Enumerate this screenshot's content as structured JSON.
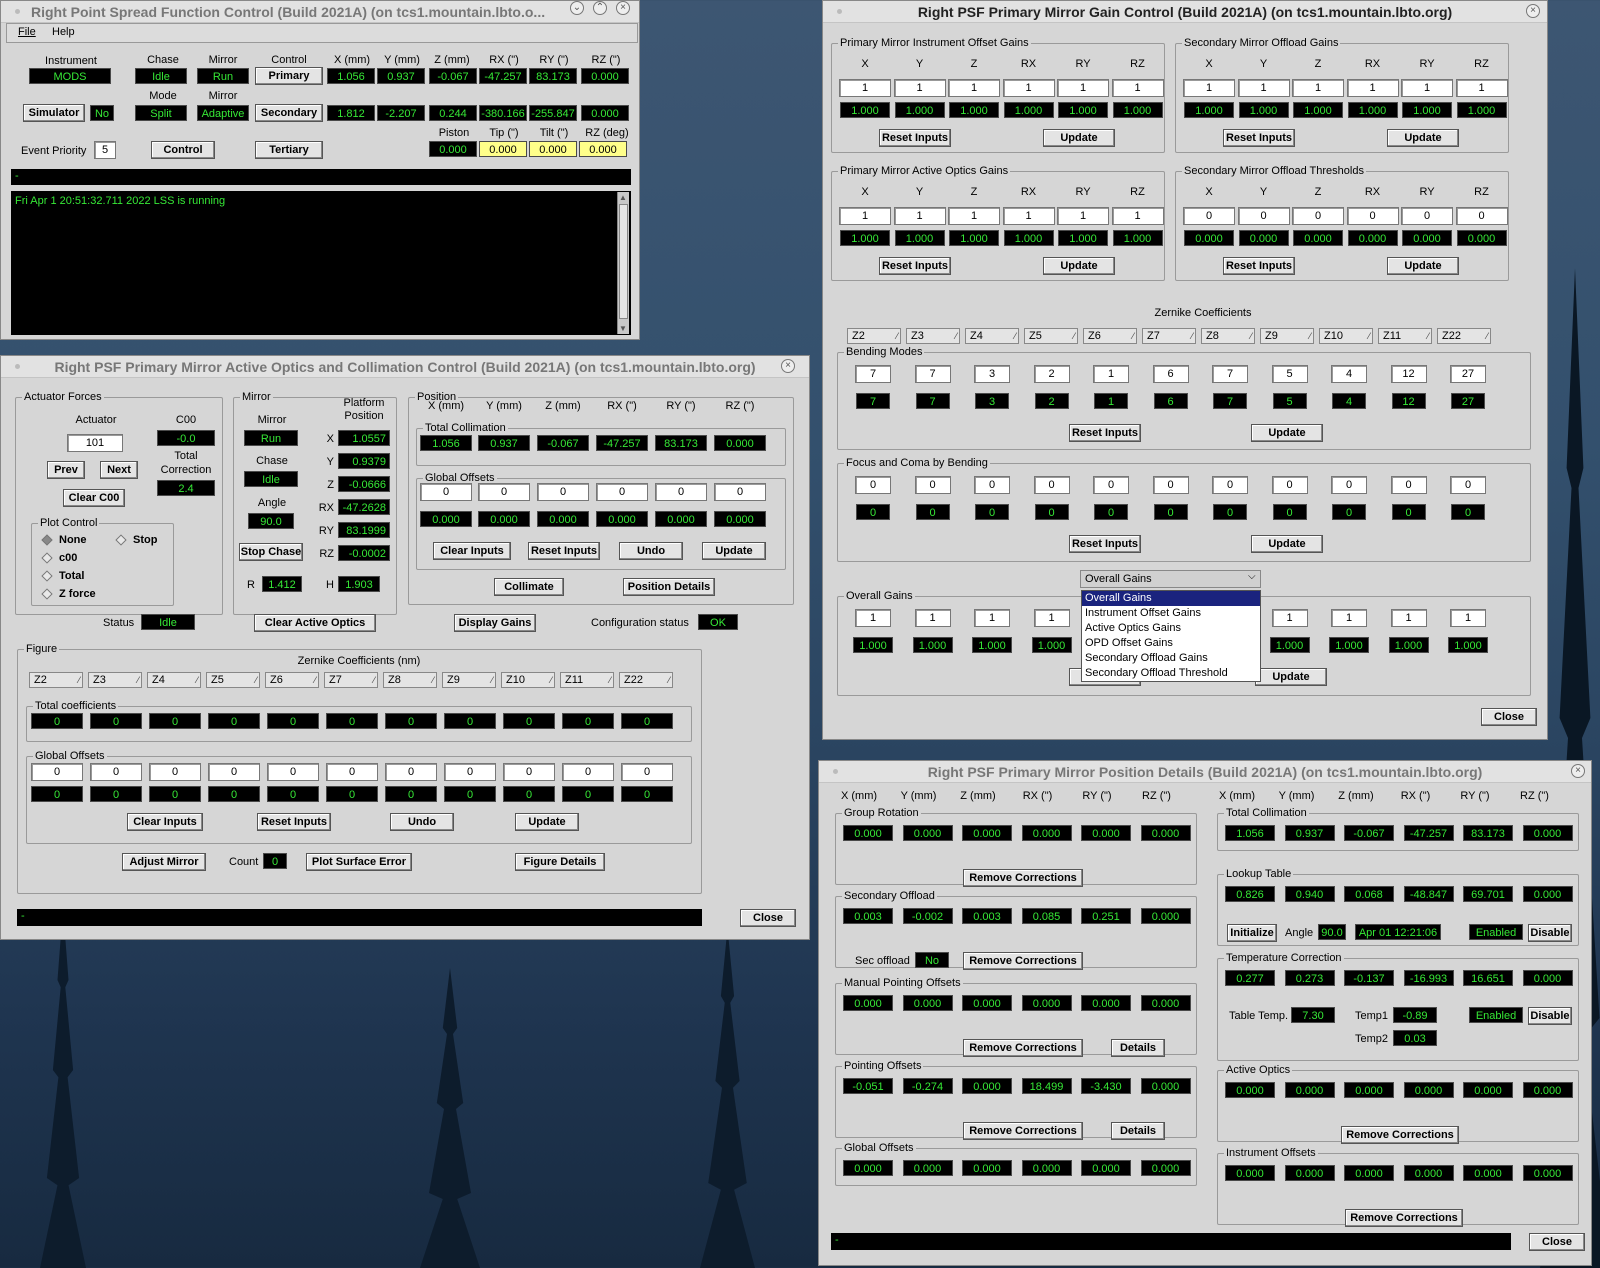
{
  "colors": {
    "display_bg": "#000000",
    "display_fg": "#36e836",
    "highlight_display": "#ffff8a",
    "panel": "#d6d6d6",
    "desktop": "#2c4560"
  },
  "win1": {
    "title": "Right Point Spread Function Control (Build 2021A) (on tcs1.mountain.lbto.o...",
    "menu": {
      "file": "File",
      "help": "Help"
    },
    "h": {
      "instrument": "Instrument",
      "chase": "Chase",
      "mirror": "Mirror",
      "control": "Control",
      "x": "X (mm)",
      "y": "Y (mm)",
      "z": "Z (mm)",
      "rx": "RX (\")",
      "ry": "RY (\")",
      "rz": "RZ (\")",
      "mode": "Mode",
      "mirror2": "Mirror",
      "piston": "Piston",
      "tip": "Tip (\")",
      "tilt": "Tilt (\")",
      "rzdeg": "RZ (deg)"
    },
    "instrument": "MODS",
    "chase": "Idle",
    "mirror": "Run",
    "primary": "Primary",
    "row1": [
      "1.056",
      "0.937",
      "-0.067",
      "-47.257",
      "83.173",
      "0.000"
    ],
    "simulator": "Simulator",
    "sim_val": "No",
    "mode": "Split",
    "mirror_mode": "Adaptive",
    "secondary": "Secondary",
    "row2": [
      "1.812",
      "-2.207",
      "0.244",
      "-380.166",
      "-255.847",
      "0.000"
    ],
    "event_priority_label": "Event Priority",
    "event_priority": "5",
    "control": "Control",
    "tertiary": "Tertiary",
    "row3": [
      "0.000",
      "0.000",
      "0.000",
      "0.000"
    ],
    "status_bar": "-",
    "log": "Fri Apr  1 20:51:32.711 2022 LSS is running"
  },
  "win2": {
    "title": "Right PSF Primary Mirror Active Optics and Collimation Control (Build 2021A) (on tcs1.mountain.lbto.org)",
    "act": {
      "group": "Actuator Forces",
      "actuator_label": "Actuator",
      "actuator": "101",
      "c00_label": "C00",
      "c00": "-0.0",
      "total_label": "Total",
      "correction_label": "Correction",
      "total": "2.4",
      "prev": "Prev",
      "next": "Next",
      "clear_c00": "Clear C00",
      "plot_group": "Plot Control",
      "none": "None",
      "stop": "Stop",
      "c00_r": "c00",
      "total_r": "Total",
      "zforce": "Z force"
    },
    "mir": {
      "group": "Mirror",
      "mirror_label": "Mirror",
      "mirror": "Run",
      "platform": "Platform",
      "position": "Position",
      "chase_label": "Chase",
      "chase": "Idle",
      "angle_label": "Angle",
      "angle": "90.0",
      "stop_chase": "Stop Chase",
      "r_label": "R",
      "r": "1.412",
      "h_label": "H",
      "h": "1.903",
      "axes": [
        "X",
        "Y",
        "Z",
        "RX",
        "RY",
        "RZ"
      ],
      "vals": [
        "1.0557",
        "0.9379",
        "-0.0666",
        "-47.2628",
        "83.1999",
        "-0.0002"
      ]
    },
    "pos": {
      "group": "Position",
      "heads": [
        "X (mm)",
        "Y (mm)",
        "Z (mm)",
        "RX (\")",
        "RY (\")",
        "RZ (\")"
      ],
      "tc_group": "Total Collimation",
      "tc": [
        "1.056",
        "0.937",
        "-0.067",
        "-47.257",
        "83.173",
        "0.000"
      ],
      "go_group": "Global Offsets",
      "go_in": [
        "0",
        "0",
        "0",
        "0",
        "0",
        "0"
      ],
      "go": [
        "0.000",
        "0.000",
        "0.000",
        "0.000",
        "0.000",
        "0.000"
      ],
      "clear_inputs": "Clear Inputs",
      "reset_inputs": "Reset Inputs",
      "undo": "Undo",
      "update": "Update",
      "collimate": "Collimate",
      "position_details": "Position Details"
    },
    "status_label": "Status",
    "status": "Idle",
    "clear_active": "Clear Active Optics",
    "display_gains": "Display Gains",
    "config_label": "Configuration status",
    "config": "OK",
    "fig": {
      "group": "Figure",
      "zernike_title": "Zernike Coefficients (nm)",
      "zern": [
        "Z2",
        "Z3",
        "Z4",
        "Z5",
        "Z6",
        "Z7",
        "Z8",
        "Z9",
        "Z10",
        "Z11",
        "Z22"
      ],
      "tot_group": "Total coefficients",
      "tot": [
        "0",
        "0",
        "0",
        "0",
        "0",
        "0",
        "0",
        "0",
        "0",
        "0",
        "0"
      ],
      "go_group": "Global Offsets",
      "go_in": [
        "0",
        "0",
        "0",
        "0",
        "0",
        "0",
        "0",
        "0",
        "0",
        "0",
        "0"
      ],
      "go": [
        "0",
        "0",
        "0",
        "0",
        "0",
        "0",
        "0",
        "0",
        "0",
        "0",
        "0"
      ],
      "clear_inputs": "Clear Inputs",
      "reset_inputs": "Reset Inputs",
      "undo": "Undo",
      "update": "Update",
      "adjust": "Adjust Mirror",
      "count_label": "Count",
      "count": "0",
      "plot_surface": "Plot Surface Error",
      "figure_details": "Figure Details"
    },
    "status_bar": "-",
    "close": "Close"
  },
  "win3": {
    "title": "Right PSF Primary Mirror Gain Control (Build 2021A) (on tcs1.mountain.lbto.org)",
    "axes": [
      "X",
      "Y",
      "Z",
      "RX",
      "RY",
      "RZ"
    ],
    "pmiog": {
      "group": "Primary Mirror Instrument Offset Gains",
      "in": [
        "1",
        "1",
        "1",
        "1",
        "1",
        "1"
      ],
      "out": [
        "1.000",
        "1.000",
        "1.000",
        "1.000",
        "1.000",
        "1.000"
      ]
    },
    "smog": {
      "group": "Secondary Mirror Offload Gains",
      "in": [
        "1",
        "1",
        "1",
        "1",
        "1",
        "1"
      ],
      "out": [
        "1.000",
        "1.000",
        "1.000",
        "1.000",
        "1.000",
        "1.000"
      ]
    },
    "pmaog": {
      "group": "Primary Mirror Active Optics Gains",
      "in": [
        "1",
        "1",
        "1",
        "1",
        "1",
        "1"
      ],
      "out": [
        "1.000",
        "1.000",
        "1.000",
        "1.000",
        "1.000",
        "1.000"
      ]
    },
    "smot": {
      "group": "Secondary Mirror Offload Thresholds",
      "in": [
        "0",
        "0",
        "0",
        "0",
        "0",
        "0"
      ],
      "out": [
        "0.000",
        "0.000",
        "0.000",
        "0.000",
        "0.000",
        "0.000"
      ]
    },
    "reset_inputs": "Reset Inputs",
    "update": "Update",
    "zernike_title": "Zernike Coefficients",
    "zern": [
      "Z2",
      "Z3",
      "Z4",
      "Z5",
      "Z6",
      "Z7",
      "Z8",
      "Z9",
      "Z10",
      "Z11",
      "Z22"
    ],
    "bm": {
      "group": "Bending Modes",
      "in": [
        "7",
        "7",
        "3",
        "2",
        "1",
        "6",
        "7",
        "5",
        "4",
        "12",
        "27"
      ],
      "out": [
        "7",
        "7",
        "3",
        "2",
        "1",
        "6",
        "7",
        "5",
        "4",
        "12",
        "27"
      ]
    },
    "fc": {
      "group": "Focus and Coma by Bending",
      "in": [
        "0",
        "0",
        "0",
        "0",
        "0",
        "0",
        "0",
        "0",
        "0",
        "0",
        "0"
      ],
      "out": [
        "0",
        "0",
        "0",
        "0",
        "0",
        "0",
        "0",
        "0",
        "0",
        "0",
        "0"
      ]
    },
    "og": {
      "group": "Overall Gains",
      "in": [
        "1",
        "1",
        "1",
        "1",
        "",
        "",
        "1",
        "1",
        "1",
        "1"
      ],
      "out": [
        "1.000",
        "1.000",
        "1.000",
        "1.000",
        "",
        "",
        "1.000",
        "1.000",
        "1.000",
        "1.000"
      ],
      "r": "R"
    },
    "dropdown": {
      "selected": "Overall Gains",
      "options": [
        "Overall Gains",
        "Instrument Offset Gains",
        "Active Optics Gains",
        "OPD Offset Gains",
        "Secondary Offload Gains",
        "Secondary Offload Threshold"
      ]
    },
    "close": "Close"
  },
  "win4": {
    "title": "Right PSF Primary Mirror Position Details (Build 2021A) (on tcs1.mountain.lbto.org)",
    "heads": [
      "X (mm)",
      "Y (mm)",
      "Z (mm)",
      "RX (\")",
      "RY (\")",
      "RZ (\")"
    ],
    "gr": {
      "group": "Group Rotation",
      "v": [
        "0.000",
        "0.000",
        "0.000",
        "0.000",
        "0.000",
        "0.000"
      ]
    },
    "so": {
      "group": "Secondary Offload",
      "v": [
        "0.003",
        "-0.002",
        "0.003",
        "0.085",
        "0.251",
        "0.000"
      ],
      "sec_label": "Sec offload",
      "sec": "No"
    },
    "mpo": {
      "group": "Manual Pointing Offsets",
      "v": [
        "0.000",
        "0.000",
        "0.000",
        "0.000",
        "0.000",
        "0.000"
      ]
    },
    "po": {
      "group": "Pointing Offsets",
      "v": [
        "-0.051",
        "-0.274",
        "0.000",
        "18.499",
        "-3.430",
        "0.000"
      ]
    },
    "go": {
      "group": "Global Offsets",
      "v": [
        "0.000",
        "0.000",
        "0.000",
        "0.000",
        "0.000",
        "0.000"
      ]
    },
    "tc": {
      "group": "Total Collimation",
      "v": [
        "1.056",
        "0.937",
        "-0.067",
        "-47.257",
        "83.173",
        "0.000"
      ]
    },
    "lt": {
      "group": "Lookup Table",
      "v": [
        "0.826",
        "0.940",
        "0.068",
        "-48.847",
        "69.701",
        "0.000"
      ],
      "initialize": "Initialize",
      "angle_label": "Angle",
      "angle": "90.0",
      "date": "Apr 01 12:21:06",
      "enabled": "Enabled",
      "disable": "Disable"
    },
    "tcorr": {
      "group": "Temperature Correction",
      "v": [
        "0.277",
        "0.273",
        "-0.137",
        "-16.993",
        "16.651",
        "0.000"
      ],
      "table_label": "Table Temp.",
      "table": "7.30",
      "temp1_label": "Temp1",
      "temp1": "-0.89",
      "temp2_label": "Temp2",
      "temp2": "0.03",
      "enabled": "Enabled",
      "disable": "Disable"
    },
    "ao": {
      "group": "Active Optics",
      "v": [
        "0.000",
        "0.000",
        "0.000",
        "0.000",
        "0.000",
        "0.000"
      ]
    },
    "io": {
      "group": "Instrument Offsets",
      "v": [
        "0.000",
        "0.000",
        "0.000",
        "0.000",
        "0.000",
        "0.000"
      ]
    },
    "remove": "Remove Corrections",
    "details": "Details",
    "status_bar": "-",
    "close": "Close"
  }
}
